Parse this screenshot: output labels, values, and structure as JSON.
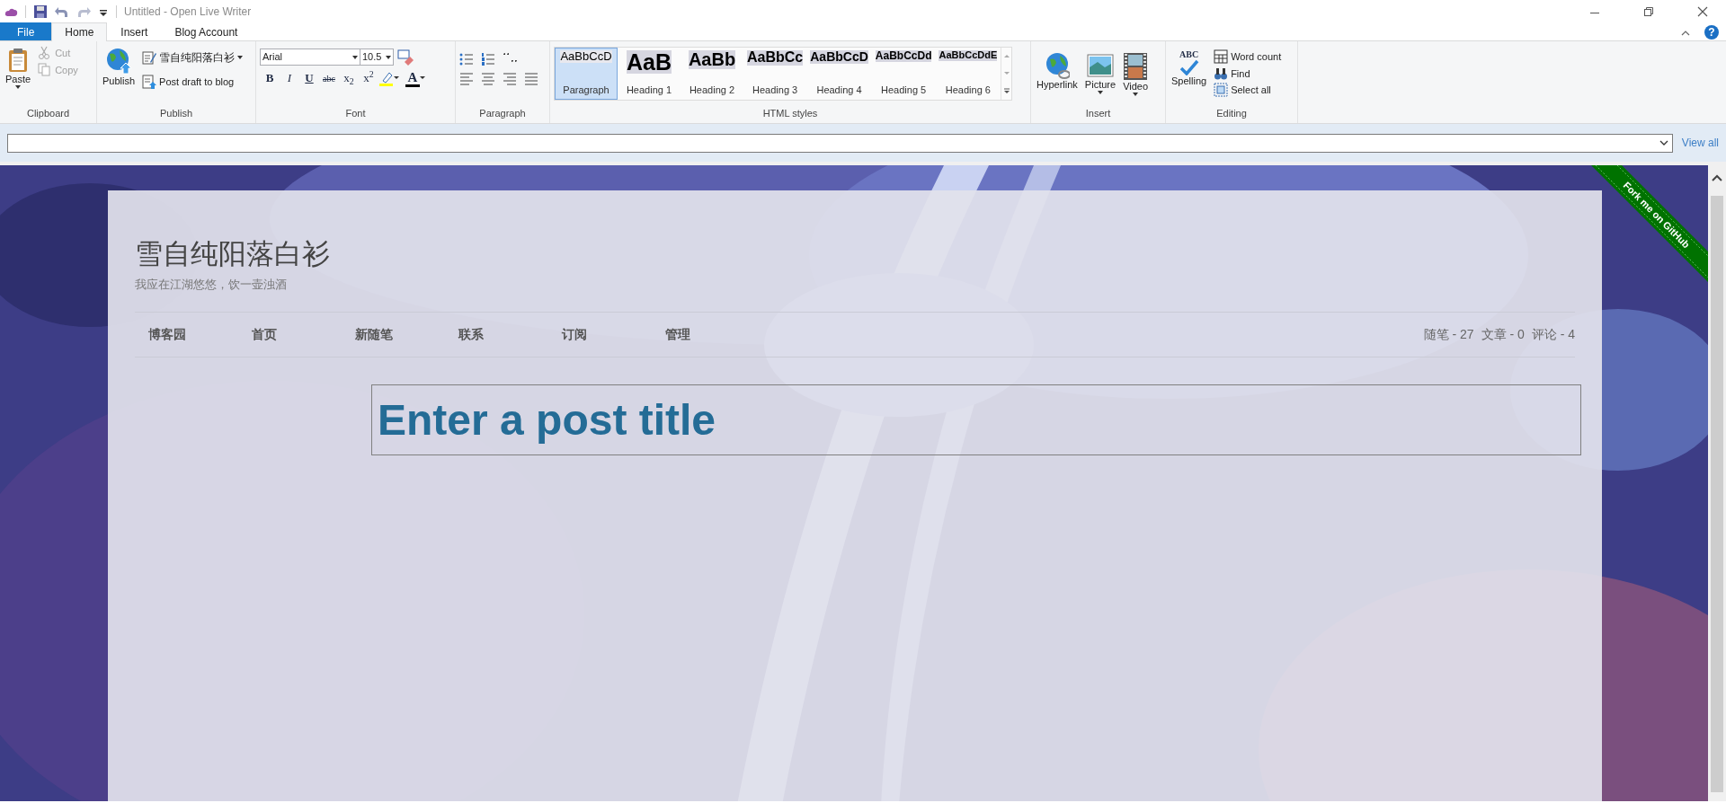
{
  "title_bar": {
    "title": "Untitled - Open Live Writer"
  },
  "tabs": [
    {
      "label": "File",
      "kind": "file",
      "selected": false
    },
    {
      "label": "Home",
      "kind": "tab",
      "selected": true
    },
    {
      "label": "Insert",
      "kind": "tab",
      "selected": false
    },
    {
      "label": "Blog Account",
      "kind": "tab",
      "selected": false
    }
  ],
  "help_button": "?",
  "ribbon": {
    "clipboard": {
      "label": "Clipboard",
      "paste": "Paste",
      "cut": {
        "label": "Cut",
        "disabled": true
      },
      "copy": {
        "label": "Copy",
        "disabled": true
      }
    },
    "publish": {
      "label": "Publish",
      "publish": "Publish",
      "blog": "雪自纯阳落白衫",
      "post_draft": "Post draft to blog"
    },
    "font": {
      "label": "Font",
      "font_name": "Arial",
      "font_size": "10.5",
      "format_buttons": [
        "B",
        "I",
        "U",
        "abc",
        "x$_{2}$",
        "x$^{2}$"
      ],
      "font_color": "A"
    },
    "paragraph": {
      "label": "Paragraph"
    },
    "html_styles": {
      "label": "HTML styles",
      "styles": [
        {
          "sample": "AaBbCcD",
          "name": "Paragraph",
          "selected": true
        },
        {
          "sample": "AaB",
          "name": "Heading 1",
          "selected": false
        },
        {
          "sample": "AaBb",
          "name": "Heading 2",
          "selected": false
        },
        {
          "sample": "AaBbCc",
          "name": "Heading 3",
          "selected": false
        },
        {
          "sample": "AaBbCcD",
          "name": "Heading 4",
          "selected": false
        },
        {
          "sample": "AaBbCcDd",
          "name": "Heading 5",
          "selected": false
        },
        {
          "sample": "AaBbCcDdE",
          "name": "Heading 6",
          "selected": false
        }
      ]
    },
    "insert": {
      "label": "Insert",
      "buttons": [
        "Hyperlink",
        "Picture",
        "Video"
      ]
    },
    "editing": {
      "label": "Editing",
      "spelling_icon_text": "ABC",
      "spelling": "Spelling",
      "buttons": [
        "Word count",
        "Find",
        "Select all"
      ]
    }
  },
  "category_bar": {
    "link": "View all"
  },
  "blog": {
    "title": "雪自纯阳落白衫",
    "subtitle": "我应在江湖悠悠，饮一壶浊酒",
    "nav": [
      "博客园",
      "首页",
      "新随笔",
      "联系",
      "订阅",
      "管理"
    ],
    "stats": [
      "随笔 - 27",
      "文章 - 0",
      "评论 - 4"
    ],
    "post_title_placeholder": "Enter a post title"
  },
  "ribbon_banner": "Fork me on GitHub"
}
